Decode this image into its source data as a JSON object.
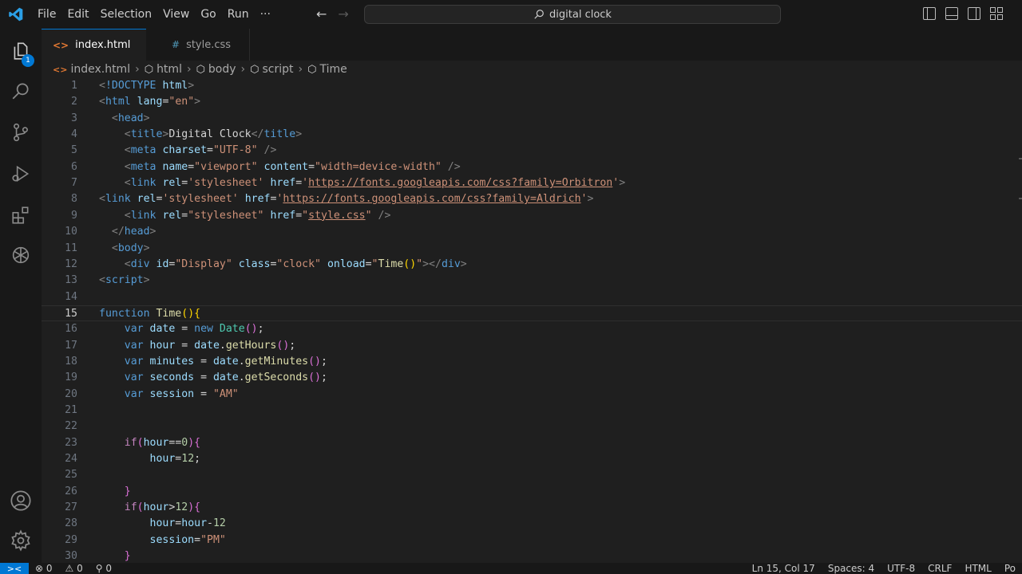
{
  "menu": {
    "items": [
      "File",
      "Edit",
      "Selection",
      "View",
      "Go",
      "Run",
      "···"
    ]
  },
  "search": {
    "text": "digital clock"
  },
  "activity_bar": {
    "explorer_badge": "1"
  },
  "tabs": [
    {
      "label": "index.html",
      "icon": "<>",
      "modified": true
    },
    {
      "label": "style.css",
      "icon": "#"
    }
  ],
  "breadcrumb": {
    "items": [
      "index.html",
      "html",
      "body",
      "script",
      "Time"
    ]
  },
  "editor": {
    "current_line": 15,
    "lines": [
      {
        "n": "1",
        "t": [
          [
            "t-br",
            "<"
          ],
          [
            "t-tag",
            "!DOCTYPE"
          ],
          [
            "t-p",
            " "
          ],
          [
            "t-attr",
            "html"
          ],
          [
            "t-br",
            ">"
          ]
        ]
      },
      {
        "n": "2",
        "t": [
          [
            "t-br",
            "<"
          ],
          [
            "t-tag",
            "html"
          ],
          [
            "t-p",
            " "
          ],
          [
            "t-attr",
            "lang"
          ],
          [
            "t-p",
            "="
          ],
          [
            "t-str",
            "\"en\""
          ],
          [
            "t-br",
            ">"
          ]
        ]
      },
      {
        "n": "3",
        "t": [
          [
            "t-p",
            "  "
          ],
          [
            "t-br",
            "<"
          ],
          [
            "t-tag",
            "head"
          ],
          [
            "t-br",
            ">"
          ]
        ]
      },
      {
        "n": "4",
        "t": [
          [
            "t-p",
            "    "
          ],
          [
            "t-br",
            "<"
          ],
          [
            "t-tag",
            "title"
          ],
          [
            "t-br",
            ">"
          ],
          [
            "t-text",
            "Digital Clock"
          ],
          [
            "t-br",
            "</"
          ],
          [
            "t-tag",
            "title"
          ],
          [
            "t-br",
            ">"
          ]
        ]
      },
      {
        "n": "5",
        "t": [
          [
            "t-p",
            "    "
          ],
          [
            "t-br",
            "<"
          ],
          [
            "t-tag",
            "meta"
          ],
          [
            "t-p",
            " "
          ],
          [
            "t-attr",
            "charset"
          ],
          [
            "t-p",
            "="
          ],
          [
            "t-str",
            "\"UTF-8\""
          ],
          [
            "t-p",
            " "
          ],
          [
            "t-br",
            "/>"
          ]
        ]
      },
      {
        "n": "6",
        "t": [
          [
            "t-p",
            "    "
          ],
          [
            "t-br",
            "<"
          ],
          [
            "t-tag",
            "meta"
          ],
          [
            "t-p",
            " "
          ],
          [
            "t-attr",
            "name"
          ],
          [
            "t-p",
            "="
          ],
          [
            "t-str",
            "\"viewport\""
          ],
          [
            "t-p",
            " "
          ],
          [
            "t-attr",
            "content"
          ],
          [
            "t-p",
            "="
          ],
          [
            "t-str",
            "\"width=device-width\""
          ],
          [
            "t-p",
            " "
          ],
          [
            "t-br",
            "/>"
          ]
        ]
      },
      {
        "n": "7",
        "t": [
          [
            "t-p",
            "    "
          ],
          [
            "t-br",
            "<"
          ],
          [
            "t-tag",
            "link"
          ],
          [
            "t-p",
            " "
          ],
          [
            "t-attr",
            "rel"
          ],
          [
            "t-p",
            "="
          ],
          [
            "t-str",
            "'stylesheet'"
          ],
          [
            "t-p",
            " "
          ],
          [
            "t-attr",
            "href"
          ],
          [
            "t-p",
            "="
          ],
          [
            "t-str",
            "'"
          ],
          [
            "t-str t-link",
            "https://fonts.googleapis.com/css?family=Orbitron"
          ],
          [
            "t-str",
            "'"
          ],
          [
            "t-br",
            ">"
          ]
        ]
      },
      {
        "n": "8",
        "t": [
          [
            "t-br",
            "<"
          ],
          [
            "t-tag",
            "link"
          ],
          [
            "t-p",
            " "
          ],
          [
            "t-attr",
            "rel"
          ],
          [
            "t-p",
            "="
          ],
          [
            "t-str",
            "'stylesheet'"
          ],
          [
            "t-p",
            " "
          ],
          [
            "t-attr",
            "href"
          ],
          [
            "t-p",
            "="
          ],
          [
            "t-str",
            "'"
          ],
          [
            "t-str t-link",
            "https://fonts.googleapis.com/css?family=Aldrich"
          ],
          [
            "t-str",
            "'"
          ],
          [
            "t-br",
            ">"
          ]
        ]
      },
      {
        "n": "9",
        "t": [
          [
            "t-p",
            "    "
          ],
          [
            "t-br",
            "<"
          ],
          [
            "t-tag",
            "link"
          ],
          [
            "t-p",
            " "
          ],
          [
            "t-attr",
            "rel"
          ],
          [
            "t-p",
            "="
          ],
          [
            "t-str",
            "\"stylesheet\""
          ],
          [
            "t-p",
            " "
          ],
          [
            "t-attr",
            "href"
          ],
          [
            "t-p",
            "="
          ],
          [
            "t-str",
            "\""
          ],
          [
            "t-str t-link",
            "style.css"
          ],
          [
            "t-str",
            "\""
          ],
          [
            "t-p",
            " "
          ],
          [
            "t-br",
            "/>"
          ]
        ]
      },
      {
        "n": "10",
        "t": [
          [
            "t-p",
            "  "
          ],
          [
            "t-br",
            "</"
          ],
          [
            "t-tag",
            "head"
          ],
          [
            "t-br",
            ">"
          ]
        ]
      },
      {
        "n": "11",
        "t": [
          [
            "t-p",
            "  "
          ],
          [
            "t-br",
            "<"
          ],
          [
            "t-tag",
            "body"
          ],
          [
            "t-br",
            ">"
          ]
        ]
      },
      {
        "n": "12",
        "t": [
          [
            "t-p",
            "    "
          ],
          [
            "t-br",
            "<"
          ],
          [
            "t-tag",
            "div"
          ],
          [
            "t-p",
            " "
          ],
          [
            "t-attr",
            "id"
          ],
          [
            "t-p",
            "="
          ],
          [
            "t-str",
            "\"Display\""
          ],
          [
            "t-p",
            " "
          ],
          [
            "t-attr",
            "class"
          ],
          [
            "t-p",
            "="
          ],
          [
            "t-str",
            "\"clock\""
          ],
          [
            "t-p",
            " "
          ],
          [
            "t-attr",
            "onload"
          ],
          [
            "t-p",
            "="
          ],
          [
            "t-str",
            "\""
          ],
          [
            "t-fn",
            "Time"
          ],
          [
            "t-br1",
            "()"
          ],
          [
            "t-str",
            "\""
          ],
          [
            "t-br",
            "></"
          ],
          [
            "t-tag",
            "div"
          ],
          [
            "t-br",
            ">"
          ]
        ]
      },
      {
        "n": "13",
        "t": [
          [
            "t-br",
            "<"
          ],
          [
            "t-tag",
            "script"
          ],
          [
            "t-br",
            ">"
          ]
        ]
      },
      {
        "n": "14",
        "t": []
      },
      {
        "n": "15",
        "t": [
          [
            "t-kw",
            "function"
          ],
          [
            "t-p",
            " "
          ],
          [
            "t-fn",
            "Time"
          ],
          [
            "t-br1",
            "()"
          ],
          [
            "t-br1",
            "{"
          ]
        ]
      },
      {
        "n": "16",
        "t": [
          [
            "t-p",
            "    "
          ],
          [
            "t-kw",
            "var"
          ],
          [
            "t-p",
            " "
          ],
          [
            "t-var",
            "date"
          ],
          [
            "t-p",
            " = "
          ],
          [
            "t-kw",
            "new"
          ],
          [
            "t-p",
            " "
          ],
          [
            "t-cls",
            "Date"
          ],
          [
            "t-br2",
            "()"
          ],
          [
            "t-p",
            ";"
          ]
        ]
      },
      {
        "n": "17",
        "t": [
          [
            "t-p",
            "    "
          ],
          [
            "t-kw",
            "var"
          ],
          [
            "t-p",
            " "
          ],
          [
            "t-var",
            "hour"
          ],
          [
            "t-p",
            " = "
          ],
          [
            "t-var",
            "date"
          ],
          [
            "t-p",
            "."
          ],
          [
            "t-fn",
            "getHours"
          ],
          [
            "t-br2",
            "()"
          ],
          [
            "t-p",
            ";"
          ]
        ]
      },
      {
        "n": "18",
        "t": [
          [
            "t-p",
            "    "
          ],
          [
            "t-kw",
            "var"
          ],
          [
            "t-p",
            " "
          ],
          [
            "t-var",
            "minutes"
          ],
          [
            "t-p",
            " = "
          ],
          [
            "t-var",
            "date"
          ],
          [
            "t-p",
            "."
          ],
          [
            "t-fn",
            "getMinutes"
          ],
          [
            "t-br2",
            "()"
          ],
          [
            "t-p",
            ";"
          ]
        ]
      },
      {
        "n": "19",
        "t": [
          [
            "t-p",
            "    "
          ],
          [
            "t-kw",
            "var"
          ],
          [
            "t-p",
            " "
          ],
          [
            "t-var",
            "seconds"
          ],
          [
            "t-p",
            " = "
          ],
          [
            "t-var",
            "date"
          ],
          [
            "t-p",
            "."
          ],
          [
            "t-fn",
            "getSeconds"
          ],
          [
            "t-br2",
            "()"
          ],
          [
            "t-p",
            ";"
          ]
        ]
      },
      {
        "n": "20",
        "t": [
          [
            "t-p",
            "    "
          ],
          [
            "t-kw",
            "var"
          ],
          [
            "t-p",
            " "
          ],
          [
            "t-var",
            "session"
          ],
          [
            "t-p",
            " = "
          ],
          [
            "t-str",
            "\"AM\""
          ]
        ]
      },
      {
        "n": "21",
        "t": []
      },
      {
        "n": "22",
        "t": []
      },
      {
        "n": "23",
        "t": [
          [
            "t-p",
            "    "
          ],
          [
            "t-ctl",
            "if"
          ],
          [
            "t-br2",
            "("
          ],
          [
            "t-var",
            "hour"
          ],
          [
            "t-p",
            "=="
          ],
          [
            "t-num",
            "0"
          ],
          [
            "t-br2",
            ")"
          ],
          [
            "t-br2",
            "{"
          ]
        ]
      },
      {
        "n": "24",
        "t": [
          [
            "t-p",
            "        "
          ],
          [
            "t-var",
            "hour"
          ],
          [
            "t-p",
            "="
          ],
          [
            "t-num",
            "12"
          ],
          [
            "t-p",
            ";"
          ]
        ]
      },
      {
        "n": "25",
        "t": []
      },
      {
        "n": "26",
        "t": [
          [
            "t-p",
            "    "
          ],
          [
            "t-br2",
            "}"
          ]
        ]
      },
      {
        "n": "27",
        "t": [
          [
            "t-p",
            "    "
          ],
          [
            "t-ctl",
            "if"
          ],
          [
            "t-br2",
            "("
          ],
          [
            "t-var",
            "hour"
          ],
          [
            "t-p",
            ">"
          ],
          [
            "t-num",
            "12"
          ],
          [
            "t-br2",
            ")"
          ],
          [
            "t-br2",
            "{"
          ]
        ]
      },
      {
        "n": "28",
        "t": [
          [
            "t-p",
            "        "
          ],
          [
            "t-var",
            "hour"
          ],
          [
            "t-p",
            "="
          ],
          [
            "t-var",
            "hour"
          ],
          [
            "t-p",
            "-"
          ],
          [
            "t-num",
            "12"
          ]
        ]
      },
      {
        "n": "29",
        "t": [
          [
            "t-p",
            "        "
          ],
          [
            "t-var",
            "session"
          ],
          [
            "t-p",
            "="
          ],
          [
            "t-str",
            "\"PM\""
          ]
        ]
      },
      {
        "n": "30",
        "t": [
          [
            "t-p",
            "    "
          ],
          [
            "t-br2",
            "}"
          ]
        ]
      }
    ]
  },
  "status": {
    "remote_icon": "><",
    "errors": "⊗ 0",
    "warnings": "⚠ 0",
    "ports": "⚲ 0",
    "position": "Ln 15, Col 17",
    "spaces": "Spaces: 4",
    "encoding": "UTF-8",
    "eol": "CRLF",
    "language": "HTML",
    "extra": "Po"
  },
  "colors": {
    "accent": "#0078d4",
    "html_icon": "#e37933",
    "css_icon": "#519aba"
  }
}
